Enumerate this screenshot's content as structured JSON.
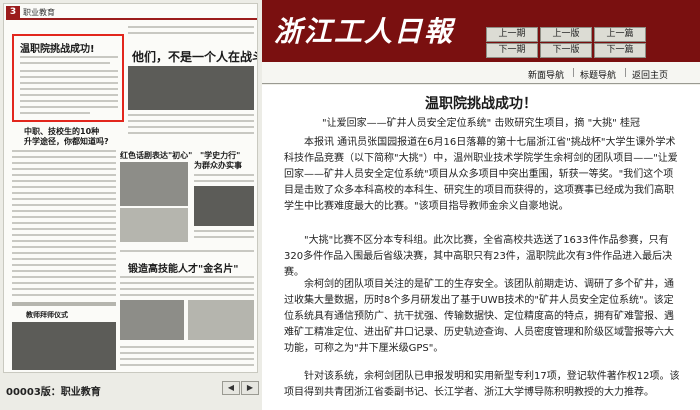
{
  "paper": {
    "section_num": "3",
    "section_name": "职业教育",
    "headline_box": "温职院挑战成功!",
    "headline_2": "他们，不是一个人在战斗",
    "side_title_1": "中职、技校生的10种",
    "side_title_2": "升学途径，你都知道吗?",
    "col_title_1": "红色话剧表达\"初心\"",
    "col_title_2": "\"学史力行\"",
    "col_title_3": "为群众办实事",
    "bottom_headline": "锻造高技能人才\"金名片\"",
    "bottom_left": "教师拜师仪式"
  },
  "page_bar": {
    "label": "00003版：职业教育",
    "prev": "◀",
    "next": "▶"
  },
  "header": {
    "logo": "浙江工人日報",
    "nav": {
      "prev_issue": "上一期",
      "prev_page": "上一版",
      "prev_article": "上一篇",
      "next_issue": "下一期",
      "next_page": "下一版",
      "next_article": "下一篇"
    }
  },
  "subnav": {
    "layout_nav": "新面导航",
    "title_nav": "标题导航",
    "home": "返回主页"
  },
  "article": {
    "title": "温职院挑战成功！",
    "subtitle": "\"让爱回家——矿井人员安全定位系统\" 击败研究生项目，摘 \"大挑\" 桂冠",
    "p1": "本报讯 通讯员张国园报道在6月16日落幕的第十七届浙江省\"挑战杯\"大学生课外学术科技作品竞赛（以下简称\"大挑\"）中，温州职业技术学院学生余柯剑的团队项目——\"让爱回家——矿井人员安全定位系统\"项目从众多项目中突出重围，斩获一等奖。\"我们这个项目是击败了众多本科高校的本科生、研究生的项目而获得的，这项赛事已经成为我们高职学生中比赛难度最大的比赛。\"该项目指导教师金余义自豪地说。",
    "p2": "\"大挑\"比赛不区分本专科组。此次比赛，全省高校共选送了1633件作品参赛，只有320多件作品入围最后省级决赛，其中高职只有23件，温职院此次有3件作品进入最后决赛。",
    "p3": "余柯剑的团队项目关注的是矿工的生存安全。该团队前期走访、调研了多个矿井，通过收集大量数据，历时8个多月研发出了基于UWB技术的\"矿井人员安全定位系统\"。该定位系统具有通信预防广、抗干扰强、传输数据快、定位精度高的特点，拥有矿难警报、遇难矿工精准定位、进出矿井口记录、历史轨迹查询、人员密度管理和阶级区域警报等六大功能，可称之为\"井下厘米级GPS\"。",
    "p4": "针对该系统，余柯剑团队已申报发明和实用新型专利17项，登记软件著作权12项。该项目得到共青团浙江省委副书记、长江学者、浙江大学博导陈积明教授的大力推荐。"
  },
  "colors": {
    "header_bg": "#7a1010",
    "highlight_border": "#e2261d",
    "section_red": "#9b1c1c"
  }
}
